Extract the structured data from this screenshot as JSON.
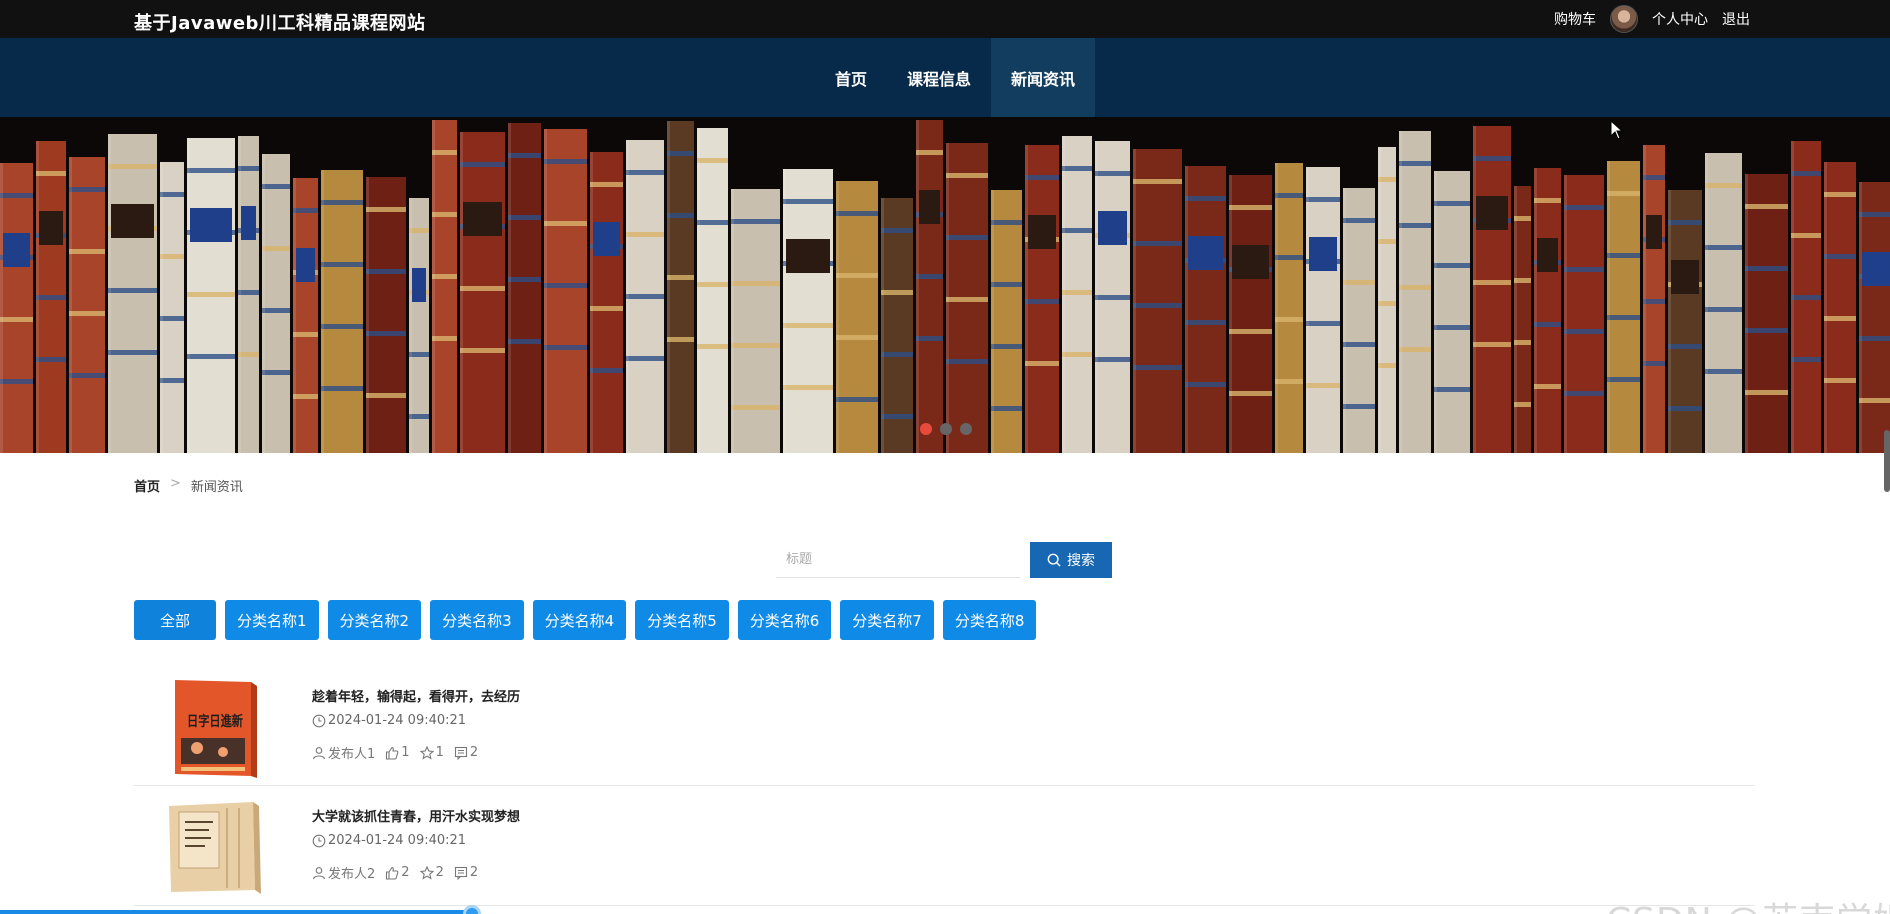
{
  "header": {
    "site_title": "基于Javaweb川工科精品课程网站",
    "cart_label": "购物车",
    "user_center_label": "个人中心",
    "logout_label": "退出"
  },
  "nav": {
    "items": [
      {
        "label": "首页"
      },
      {
        "label": "课程信息"
      },
      {
        "label": "新闻资讯"
      }
    ],
    "active_index": 2
  },
  "banner": {
    "slide_count": 3,
    "active_slide": 0
  },
  "breadcrumb": {
    "home": "首页",
    "separator": ">",
    "current": "新闻资讯"
  },
  "search": {
    "placeholder": "标题",
    "value": "",
    "button_label": "搜索"
  },
  "categories": [
    {
      "label": "全部"
    },
    {
      "label": "分类名称1"
    },
    {
      "label": "分类名称2"
    },
    {
      "label": "分类名称3"
    },
    {
      "label": "分类名称4"
    },
    {
      "label": "分类名称5"
    },
    {
      "label": "分类名称6"
    },
    {
      "label": "分类名称7"
    },
    {
      "label": "分类名称8"
    }
  ],
  "news": [
    {
      "title": "趁着年轻，输得起，看得开，去经历",
      "time": "2024-01-24 09:40:21",
      "publisher": "发布人1",
      "likes": "1",
      "favorites": "1",
      "comments": "2",
      "cover_text": "日字日進新"
    },
    {
      "title": "大学就该抓住青春，用汗水实现梦想",
      "time": "2024-01-24 09:40:21",
      "publisher": "发布人2",
      "likes": "2",
      "favorites": "2",
      "comments": "2",
      "cover_text": ""
    }
  ],
  "watermark": "CSDN @苏南学姐",
  "colors": {
    "topbar": "#111111",
    "navbar": "#082a4a",
    "nav_active": "#133d5f",
    "category_button": "#0f8ae6",
    "search_button": "#1767b3",
    "dot_active": "#e84b3c"
  }
}
